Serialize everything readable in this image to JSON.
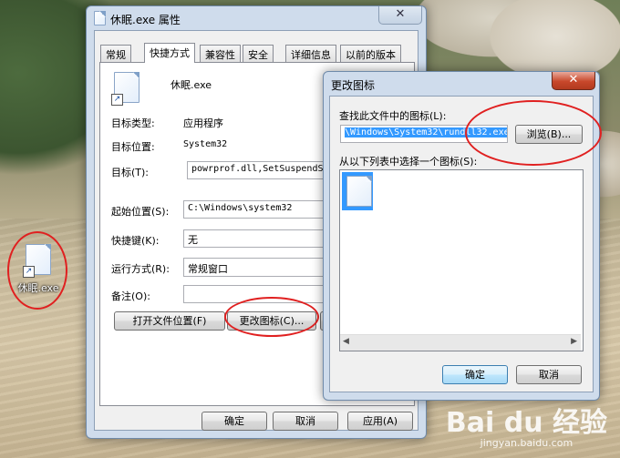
{
  "desktop": {
    "icon_label": "休眠.exe"
  },
  "props": {
    "title": "休眠.exe 属性",
    "tabs": [
      "常规",
      "快捷方式",
      "兼容性",
      "安全",
      "详细信息",
      "以前的版本"
    ],
    "file_name": "休眠.exe",
    "target_type_label": "目标类型:",
    "target_type_value": "应用程序",
    "target_loc_label": "目标位置:",
    "target_loc_value": "System32",
    "target_label": "目标(T):",
    "target_value": "powrprof.dll,SetSuspendState",
    "start_in_label": "起始位置(S):",
    "start_in_value": "C:\\Windows\\system32",
    "hotkey_label": "快捷键(K):",
    "hotkey_value": "无",
    "run_label": "运行方式(R):",
    "run_value": "常规窗口",
    "comment_label": "备注(O):",
    "comment_value": "",
    "open_location_btn": "打开文件位置(F)",
    "change_icon_btn": "更改图标(C)...",
    "ok_btn": "确定",
    "cancel_btn": "取消",
    "apply_btn": "应用(A)"
  },
  "change_icon": {
    "title": "更改图标",
    "find_label": "查找此文件中的图标(L):",
    "path_value": "\\Windows\\System32\\rundll32.exe",
    "browse_btn": "浏览(B)...",
    "select_label": "从以下列表中选择一个图标(S):",
    "ok_btn": "确定",
    "cancel_btn": "取消"
  },
  "watermark": {
    "main": "Bai du 经验",
    "sub": "jingyan.baidu.com"
  },
  "colors": {
    "annotation": "#e02020",
    "selection": "#3399ff"
  },
  "icons": [
    "document-icon",
    "shortcut-arrow-icon",
    "close-icon",
    "scroll-left-icon",
    "scroll-right-icon"
  ]
}
